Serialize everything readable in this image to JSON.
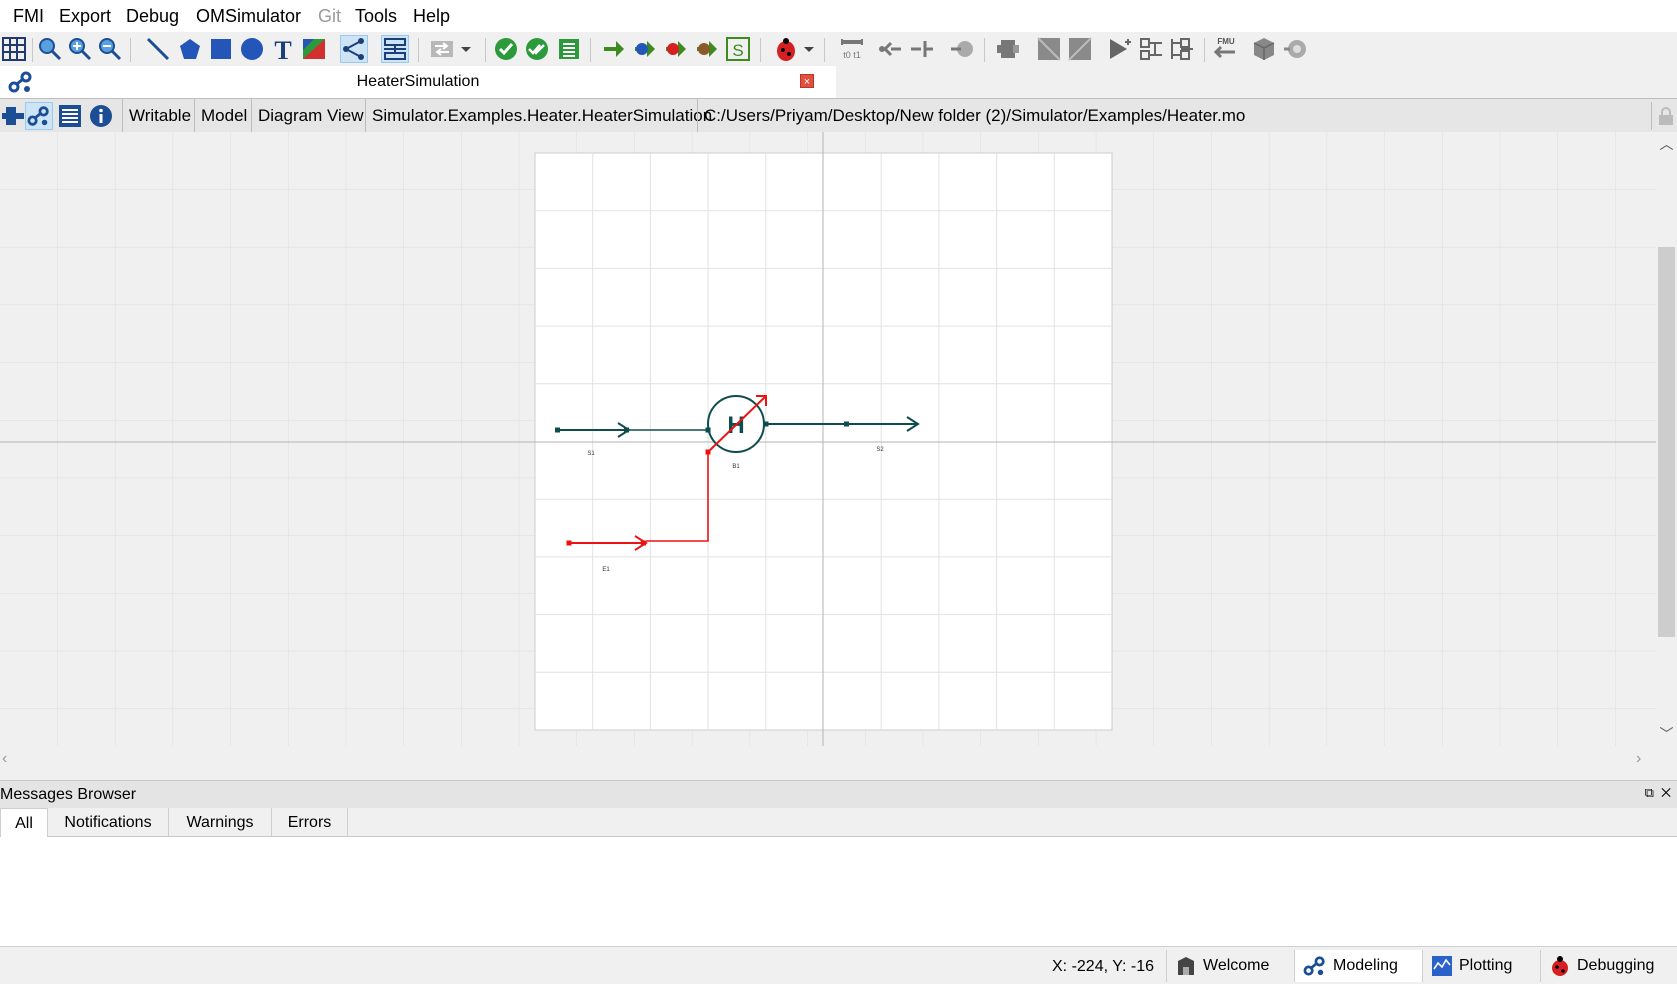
{
  "menu": [
    "FMI",
    "Export",
    "Debug",
    "OMSimulator",
    "Git",
    "Tools",
    "Help"
  ],
  "menu_disabled": [
    "Git"
  ],
  "document": {
    "title": "HeaterSimulation",
    "close_label": "×",
    "access": "Writable",
    "class_type": "Model",
    "view": "Diagram View",
    "class_name": "Simulator.Examples.Heater.HeaterSimulation",
    "file_path": "C:/Users/Priyam/Desktop/New folder (2)/Simulator/Examples/Heater.mo"
  },
  "diagram": {
    "heater_symbol": "H",
    "labels": {
      "source1": "S1",
      "heater": "B1",
      "sink": "S2",
      "energy": "E1"
    },
    "colors": {
      "flow": "#0e4d4d",
      "energy": "#ee1111",
      "grid": "#dcdcdc",
      "canvas": "#ffffff"
    }
  },
  "messages": {
    "title": "Messages Browser",
    "tabs": [
      "All",
      "Notifications",
      "Warnings",
      "Errors"
    ],
    "selected_tab": "All"
  },
  "status": {
    "coords": "X: -224, Y: -16",
    "perspectives": [
      "Welcome",
      "Modeling",
      "Plotting",
      "Debugging"
    ],
    "selected_perspective": "Modeling"
  },
  "icons": {
    "toolbar": [
      "grid-icon",
      "zoom-icon",
      "zoom-in-icon",
      "zoom-out-icon",
      "line-icon",
      "polygon-icon",
      "rectangle-icon",
      "ellipse-icon",
      "text-icon",
      "bitmap-icon",
      "connect-mode-icon",
      "transition-mode-icon",
      "swap-icon",
      "check-icon",
      "check-all-icon",
      "instantiate-icon",
      "simulate-icon",
      "simulate-debug-icon",
      "simulate-algorithmic-debug-icon",
      "animation-icon",
      "ssp-icon",
      "debug-icon",
      "fmi-timing-icon",
      "ssp-add-icon",
      "ssp-connect-icon",
      "ssp-remove-icon",
      "add-component-icon",
      "add-submodel-icon",
      "add-model-icon",
      "simulate-ssp-icon",
      "add-connector-icon",
      "add-bus-icon",
      "import-fmu-icon",
      "ssp-system-icon",
      "ssp-sim-icon"
    ]
  }
}
